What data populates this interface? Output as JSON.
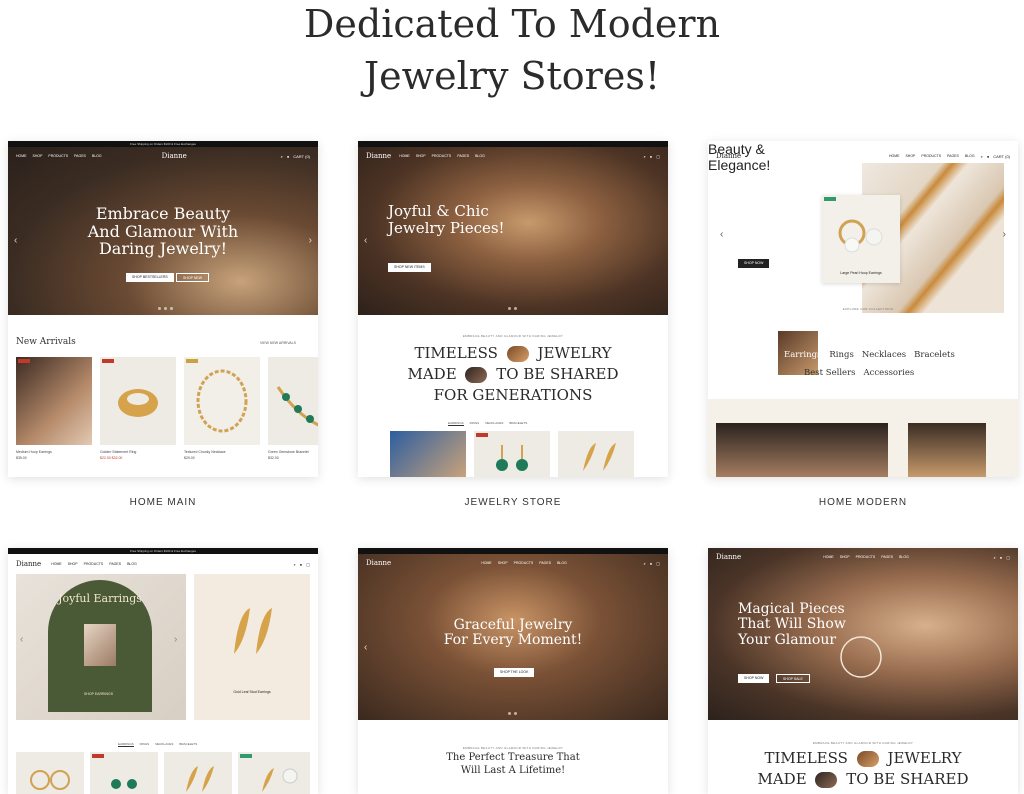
{
  "heading": {
    "line1": "Dedicated To Modern",
    "line2": "Jewelry Stores!"
  },
  "colors": {
    "accent_red": "#c0392b",
    "accent_green": "#2f9a6b",
    "olive": "#4b5a36"
  },
  "demos": [
    {
      "label": "HOME MAIN",
      "topbar": "Free Shipping on Orders $100 & Free Exchanges",
      "logo": "Dianne",
      "nav": [
        "HOME",
        "SHOP",
        "PRODUCTS",
        "PAGES",
        "BLOG"
      ],
      "cart": "CART (0)",
      "headline": [
        "Embrace Beauty",
        "And Glamour With",
        "Daring Jewelry!"
      ],
      "buttons": [
        "SHOP BESTSELLERS",
        "SHOP NEW"
      ],
      "section_title": "New Arrivals",
      "section_link": "VIEW NEW ARRIVALS",
      "products": [
        {
          "name": "Medium Hoop Earrings",
          "price": "$35.00"
        },
        {
          "name": "Golden Statement Ring",
          "price": "$22.00  $32.00"
        },
        {
          "name": "Textured Chunky Necklace",
          "price": "$29.00"
        },
        {
          "name": "Green Gemstone Bracelet",
          "price": "$32.00"
        }
      ]
    },
    {
      "label": "JEWELRY STORE",
      "logo": "Dianne",
      "nav": [
        "HOME",
        "SHOP",
        "PRODUCTS",
        "PAGES",
        "BLOG"
      ],
      "headline": [
        "Joyful & Chic",
        "Jewelry Pieces!"
      ],
      "buttons": [
        "SHOP NEW ITEMS"
      ],
      "eyebrow": "EMBRACE BEAUTY AND GLAMOUR WITH DARING JEWELRY",
      "statement": [
        "TIMELESS",
        "JEWELRY",
        "MADE",
        "TO BE SHARED",
        "FOR GENERATIONS"
      ],
      "tabs": [
        "EARRINGS",
        "RINGS",
        "NECKLACES",
        "BRACELETS"
      ]
    },
    {
      "label": "HOME MODERN",
      "logo": "Dianne",
      "nav": [
        "HOME",
        "SHOP",
        "PRODUCTS",
        "PAGES",
        "BLOG"
      ],
      "cart": "CART (0)",
      "headline": [
        "Beauty &",
        "Elegance!"
      ],
      "buttons": [
        "SHOP NOW"
      ],
      "product_card": "Large Pearl Hoop Earrings",
      "collections_eyebrow": "EXPLORE OUR COLLECTIONS",
      "collections": [
        "Earrings",
        "Rings",
        "Necklaces",
        "Bracelets",
        "Best Sellers",
        "Accessories"
      ]
    },
    {
      "logo": "Dianne",
      "nav": [
        "HOME",
        "SHOP",
        "PRODUCTS",
        "PAGES",
        "BLOG"
      ],
      "topbar": "Free Shipping on Orders $100 & Free Exchanges",
      "arch_title": "Joyful Earrings",
      "buttons": [
        "SHOP EARRINGS"
      ],
      "product_card": "Gold Leaf Stud Earrings",
      "tabs": [
        "EARRINGS",
        "RINGS",
        "NECKLACES",
        "BRACELETS"
      ]
    },
    {
      "logo": "Dianne",
      "nav": [
        "HOME",
        "SHOP",
        "PRODUCTS",
        "PAGES",
        "BLOG"
      ],
      "headline": [
        "Graceful Jewelry",
        "For Every Moment!"
      ],
      "buttons": [
        "SHOP THE LOOK"
      ],
      "eyebrow": "EMBRACE BEAUTY AND GLAMOUR WITH DARING JEWELRY",
      "statement": [
        "The Perfect Treasure That",
        "Will Last A Lifetime!"
      ]
    },
    {
      "logo": "Dianne",
      "nav": [
        "HOME",
        "SHOP",
        "PRODUCTS",
        "PAGES",
        "BLOG"
      ],
      "headline": [
        "Magical Pieces",
        "That Will Show",
        "Your Glamour"
      ],
      "buttons": [
        "SHOP NOW",
        "SHOP SALE"
      ],
      "eyebrow": "EMBRACE BEAUTY AND GLAMOUR WITH DARING JEWELRY",
      "statement": [
        "TIMELESS",
        "JEWELRY",
        "MADE",
        "TO BE SHARED"
      ]
    }
  ]
}
